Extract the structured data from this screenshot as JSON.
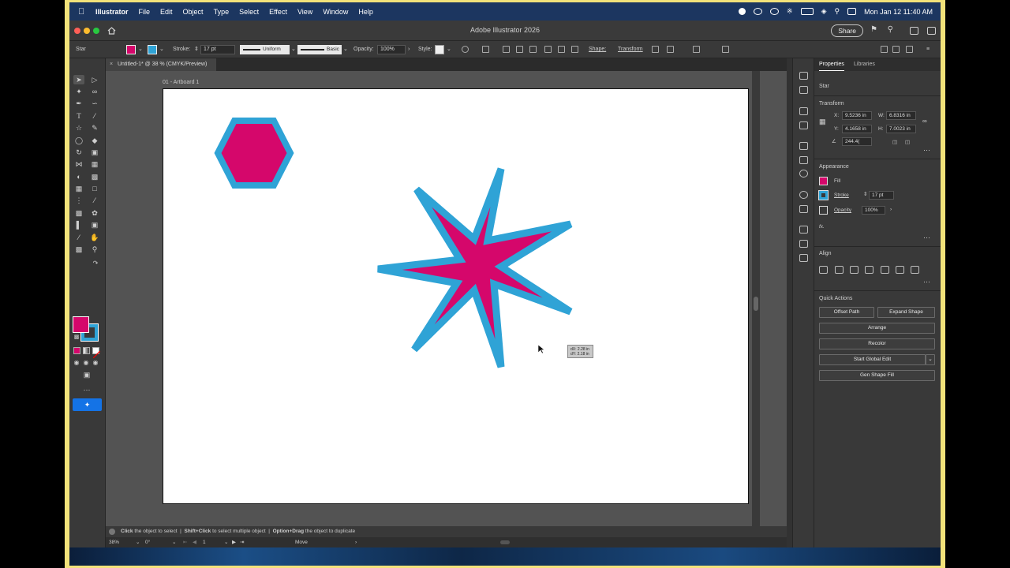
{
  "menubar": {
    "app": "Illustrator",
    "items": [
      "File",
      "Edit",
      "Object",
      "Type",
      "Select",
      "Effect",
      "View",
      "Window",
      "Help"
    ],
    "datetime": "Mon Jan 12  11:40 AM"
  },
  "titlebar": {
    "title": "Adobe Illustrator 2026",
    "share_label": "Share"
  },
  "controlbar": {
    "object_type": "Star",
    "stroke_label": "Stroke:",
    "stroke_value": "17 pt",
    "profile": "Uniform",
    "brush": "Basic",
    "opacity_label": "Opacity:",
    "opacity_value": "100%",
    "style_label": "Style:",
    "shape_label": "Shape:",
    "transform_label": "Transform"
  },
  "document": {
    "tab_title": "Untitled-1* @ 38 % (CMYK/Preview)",
    "artboard_label": "01 - Artboard 1"
  },
  "colors": {
    "fill": "#d5076b",
    "stroke": "#2fa3d6",
    "canvas_bg": "#535353",
    "panel_bg": "#393939"
  },
  "canvas": {
    "measure_dx": "dX: 2.28 in",
    "measure_dy": "dY: 2.18 in"
  },
  "hint": {
    "click": "Click",
    "click_text": "the object to select",
    "shift": "Shift+Click",
    "shift_text": "to select multiple object",
    "option": "Option+Drag",
    "option_text": "the object to duplicate"
  },
  "status": {
    "zoom": "38%",
    "rotation": "0°",
    "artboard_num": "1",
    "tool": "Move"
  },
  "panel": {
    "tabs": [
      "Properties",
      "Libraries"
    ],
    "object": "Star",
    "transform": {
      "title": "Transform",
      "x": "9.5236 in",
      "y": "4.1658 in",
      "w": "6.8316 in",
      "h": "7.0023 in",
      "angle": "244.4(",
      "x_label": "X:",
      "y_label": "Y:",
      "w_label": "W:",
      "h_label": "H:"
    },
    "appearance": {
      "title": "Appearance",
      "fill_label": "Fill",
      "stroke_label": "Stroke",
      "stroke_value": "17 pt",
      "opacity_label": "Opacity",
      "opacity_value": "100%",
      "fx": "fx."
    },
    "align": {
      "title": "Align"
    },
    "quick_actions": {
      "title": "Quick Actions",
      "offset_path": "Offset Path",
      "expand_shape": "Expand Shape",
      "arrange": "Arrange",
      "recolor": "Recolor",
      "global_edit": "Start Global Edit",
      "gen_shape_fill": "Gen Shape Fill"
    }
  }
}
